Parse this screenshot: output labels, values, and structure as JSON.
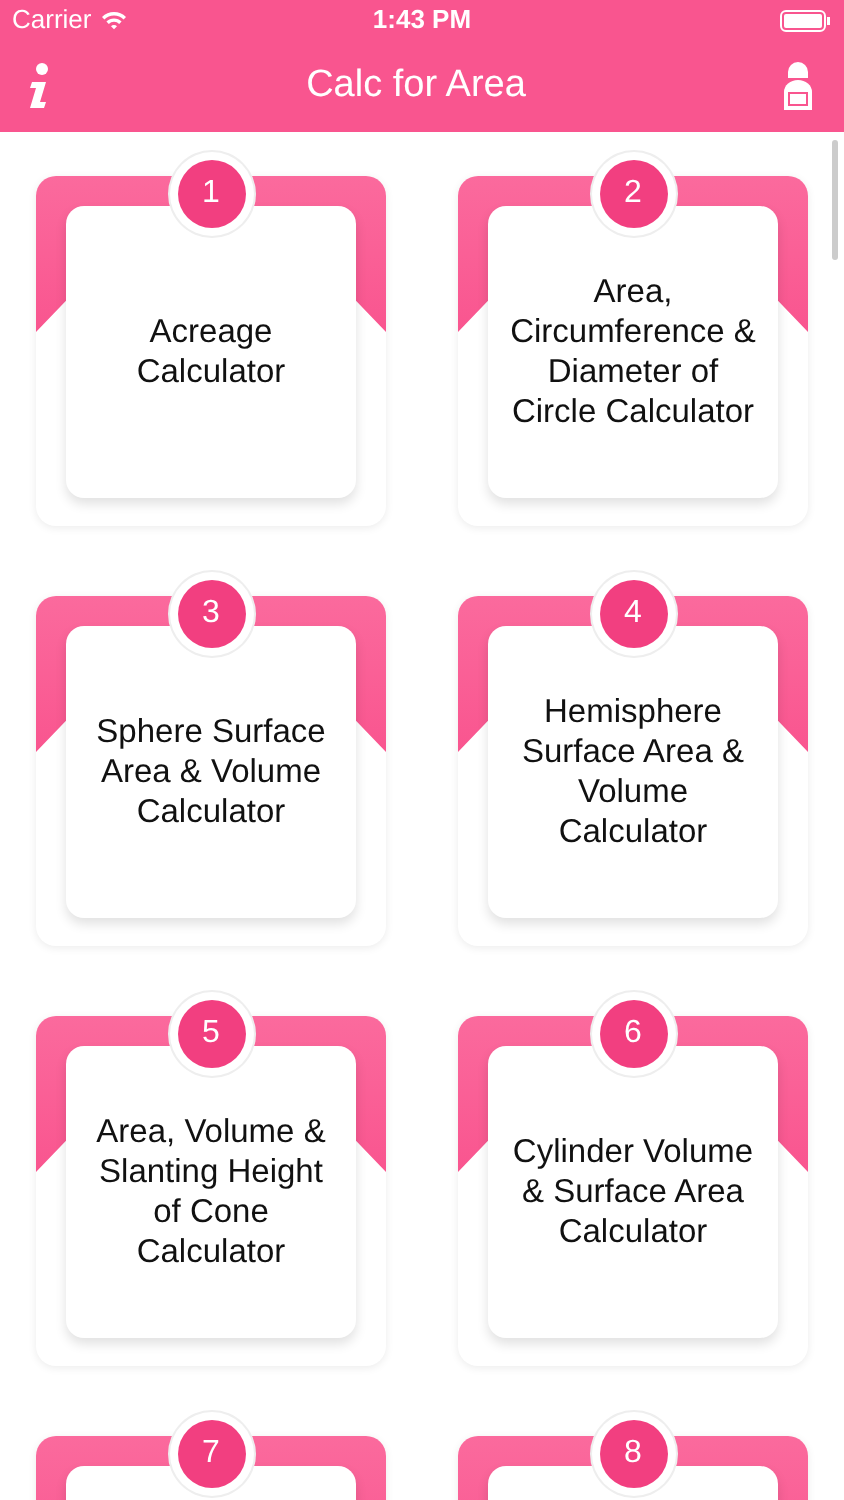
{
  "status_bar": {
    "carrier": "Carrier",
    "time": "1:43 PM"
  },
  "nav_bar": {
    "title": "Calc for Area"
  },
  "tiles": [
    {
      "number": "1",
      "title": "Acreage Calculator"
    },
    {
      "number": "2",
      "title": "Area, Circumference & Diameter of Circle Calculator"
    },
    {
      "number": "3",
      "title": "Sphere Surface Area & Volume Calculator"
    },
    {
      "number": "4",
      "title": "Hemisphere Surface Area & Volume Calculator"
    },
    {
      "number": "5",
      "title": "Area, Volume & Slanting Height of Cone Calculator"
    },
    {
      "number": "6",
      "title": "Cylinder Volume & Surface Area Calculator"
    },
    {
      "number": "7"
    },
    {
      "number": "8"
    }
  ]
}
